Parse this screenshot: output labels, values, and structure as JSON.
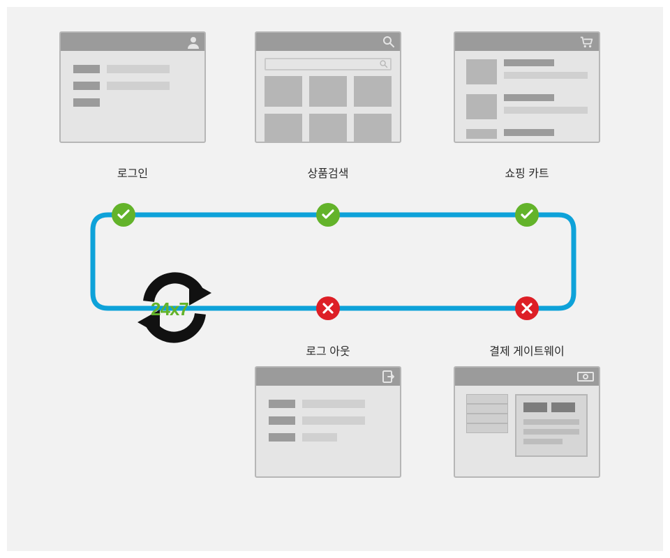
{
  "labels": {
    "login": "로그인",
    "search": "상품검색",
    "cart": "쇼핑 카트",
    "logout": "로그 아웃",
    "gateway": "결제 게이트웨이"
  },
  "cycle_label": "24x7",
  "nodes": {
    "login": {
      "status": "ok"
    },
    "search": {
      "status": "ok"
    },
    "cart": {
      "status": "ok"
    },
    "gateway": {
      "status": "error"
    },
    "logout": {
      "status": "error"
    }
  },
  "colors": {
    "path": "#0ea2d9",
    "ok": "#63b32a",
    "error": "#dd1f26",
    "chrome": "#9b9b9b"
  },
  "icons": {
    "login": "user-icon",
    "search": "magnifier-icon",
    "cart": "cart-icon",
    "logout": "exit-icon",
    "gateway": "money-icon"
  }
}
